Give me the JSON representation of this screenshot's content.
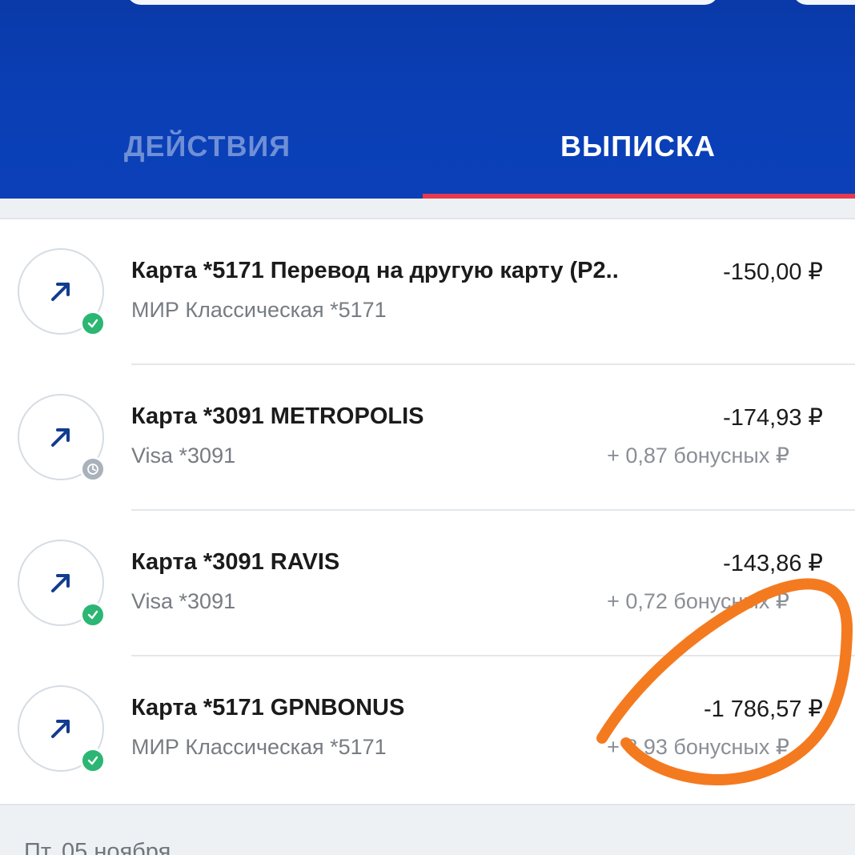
{
  "tabs": {
    "actions": "ДЕЙСТВИЯ",
    "statement": "ВЫПИСКА"
  },
  "transactions": [
    {
      "title": "Карта *5171 Перевод на другую карту (P2..",
      "subtitle": "МИР Классическая *5171",
      "amount": "-150,00 ₽",
      "bonus": "",
      "status": "completed"
    },
    {
      "title": "Карта *3091 METROPOLIS",
      "subtitle": "Visa *3091",
      "amount": "-174,93 ₽",
      "bonus": "+ 0,87 бонусных ₽",
      "status": "pending"
    },
    {
      "title": "Карта *3091 RAVIS",
      "subtitle": "Visa *3091",
      "amount": "-143,86 ₽",
      "bonus": "+ 0,72 бонусных ₽",
      "status": "completed"
    },
    {
      "title": "Карта *5171 GPNBONUS",
      "subtitle": "МИР Классическая *5171",
      "amount": "-1 786,57 ₽",
      "bonus": "+ 8,93 бонусных ₽",
      "status": "completed"
    }
  ],
  "next_date_header": "Пт, 05 ноября",
  "colors": {
    "header_blue": "#0a3fb6",
    "tab_indicator": "#e63a4e",
    "status_ok": "#2bb673",
    "status_pending": "#a9b1bc",
    "arrow_icon": "#123c8f",
    "annotation_orange": "#f47a20"
  },
  "icons": {
    "outgoing": "arrow-up-right-icon",
    "completed": "check-circle-icon",
    "pending": "clock-icon"
  }
}
